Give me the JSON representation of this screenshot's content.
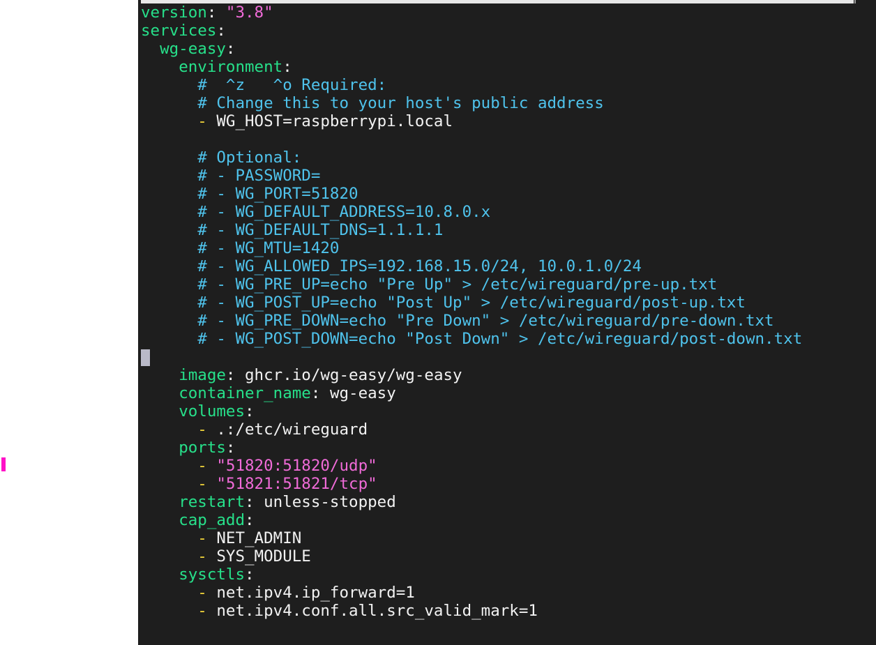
{
  "window": {
    "type": "terminal-text-editor",
    "file_format": "docker-compose-yaml"
  },
  "colors": {
    "background": "#1e1e1e",
    "key": "#27e08a",
    "string": "#f06bd8",
    "comment": "#4fc3ec",
    "list_dash": "#f0d33a",
    "plain": "#f2f2f2",
    "cursor": "#b9b9c8",
    "left_marker": "#ff10c8"
  },
  "lines": [
    [
      {
        "t": "version",
        "c": "key"
      },
      {
        "t": ": ",
        "c": "punct"
      },
      {
        "t": "\"3.8\"",
        "c": "str"
      }
    ],
    [
      {
        "t": "services",
        "c": "key"
      },
      {
        "t": ":",
        "c": "punct"
      }
    ],
    [
      {
        "t": "  "
      },
      {
        "t": "wg-easy",
        "c": "key"
      },
      {
        "t": ":",
        "c": "punct"
      }
    ],
    [
      {
        "t": "    "
      },
      {
        "t": "environment",
        "c": "key"
      },
      {
        "t": ":",
        "c": "punct"
      }
    ],
    [
      {
        "t": "      "
      },
      {
        "t": "#  ^z   ^o Required:",
        "c": "comment"
      }
    ],
    [
      {
        "t": "      "
      },
      {
        "t": "# Change this to your host's public address",
        "c": "comment"
      }
    ],
    [
      {
        "t": "      "
      },
      {
        "t": "- ",
        "c": "dash"
      },
      {
        "t": "WG_HOST=raspberrypi.local",
        "c": "val"
      }
    ],
    [],
    [
      {
        "t": "      "
      },
      {
        "t": "# Optional:",
        "c": "comment"
      }
    ],
    [
      {
        "t": "      "
      },
      {
        "t": "# - PASSWORD=",
        "c": "comment"
      }
    ],
    [
      {
        "t": "      "
      },
      {
        "t": "# - WG_PORT=51820",
        "c": "comment"
      }
    ],
    [
      {
        "t": "      "
      },
      {
        "t": "# - WG_DEFAULT_ADDRESS=10.8.0.x",
        "c": "comment"
      }
    ],
    [
      {
        "t": "      "
      },
      {
        "t": "# - WG_DEFAULT_DNS=1.1.1.1",
        "c": "comment"
      }
    ],
    [
      {
        "t": "      "
      },
      {
        "t": "# - WG_MTU=1420",
        "c": "comment"
      }
    ],
    [
      {
        "t": "      "
      },
      {
        "t": "# - WG_ALLOWED_IPS=192.168.15.0/24, 10.0.1.0/24",
        "c": "comment"
      }
    ],
    [
      {
        "t": "      "
      },
      {
        "t": "# - WG_PRE_UP=echo \"Pre Up\" > /etc/wireguard/pre-up.txt",
        "c": "comment"
      }
    ],
    [
      {
        "t": "      "
      },
      {
        "t": "# - WG_POST_UP=echo \"Post Up\" > /etc/wireguard/post-up.txt",
        "c": "comment"
      }
    ],
    [
      {
        "t": "      "
      },
      {
        "t": "# - WG_PRE_DOWN=echo \"Pre Down\" > /etc/wireguard/pre-down.txt",
        "c": "comment"
      }
    ],
    [
      {
        "t": "      "
      },
      {
        "t": "# - WG_POST_DOWN=echo \"Post Down\" > /etc/wireguard/post-down.txt",
        "c": "comment"
      }
    ],
    [
      {
        "cursor": true
      }
    ],
    [
      {
        "t": "    "
      },
      {
        "t": "image",
        "c": "key"
      },
      {
        "t": ": ",
        "c": "punct"
      },
      {
        "t": "ghcr.io/wg-easy/wg-easy",
        "c": "val"
      }
    ],
    [
      {
        "t": "    "
      },
      {
        "t": "container_name",
        "c": "key"
      },
      {
        "t": ": ",
        "c": "punct"
      },
      {
        "t": "wg-easy",
        "c": "val"
      }
    ],
    [
      {
        "t": "    "
      },
      {
        "t": "volumes",
        "c": "key"
      },
      {
        "t": ":",
        "c": "punct"
      }
    ],
    [
      {
        "t": "      "
      },
      {
        "t": "- ",
        "c": "dash"
      },
      {
        "t": ".:/etc/wireguard",
        "c": "val"
      }
    ],
    [
      {
        "t": "    "
      },
      {
        "t": "ports",
        "c": "key"
      },
      {
        "t": ":",
        "c": "punct"
      }
    ],
    [
      {
        "t": "      "
      },
      {
        "t": "- ",
        "c": "dash"
      },
      {
        "t": "\"51820:51820/udp\"",
        "c": "str"
      }
    ],
    [
      {
        "t": "      "
      },
      {
        "t": "- ",
        "c": "dash"
      },
      {
        "t": "\"51821:51821/tcp\"",
        "c": "str"
      }
    ],
    [
      {
        "t": "    "
      },
      {
        "t": "restart",
        "c": "key"
      },
      {
        "t": ": ",
        "c": "punct"
      },
      {
        "t": "unless-stopped",
        "c": "val"
      }
    ],
    [
      {
        "t": "    "
      },
      {
        "t": "cap_add",
        "c": "key"
      },
      {
        "t": ":",
        "c": "punct"
      }
    ],
    [
      {
        "t": "      "
      },
      {
        "t": "- ",
        "c": "dash"
      },
      {
        "t": "NET_ADMIN",
        "c": "val"
      }
    ],
    [
      {
        "t": "      "
      },
      {
        "t": "- ",
        "c": "dash"
      },
      {
        "t": "SYS_MODULE",
        "c": "val"
      }
    ],
    [
      {
        "t": "    "
      },
      {
        "t": "sysctls",
        "c": "key"
      },
      {
        "t": ":",
        "c": "punct"
      }
    ],
    [
      {
        "t": "      "
      },
      {
        "t": "- ",
        "c": "dash"
      },
      {
        "t": "net.ipv4.ip_forward=1",
        "c": "val"
      }
    ],
    [
      {
        "t": "      "
      },
      {
        "t": "- ",
        "c": "dash"
      },
      {
        "t": "net.ipv4.conf.all.src_valid_mark=1",
        "c": "val"
      }
    ]
  ]
}
